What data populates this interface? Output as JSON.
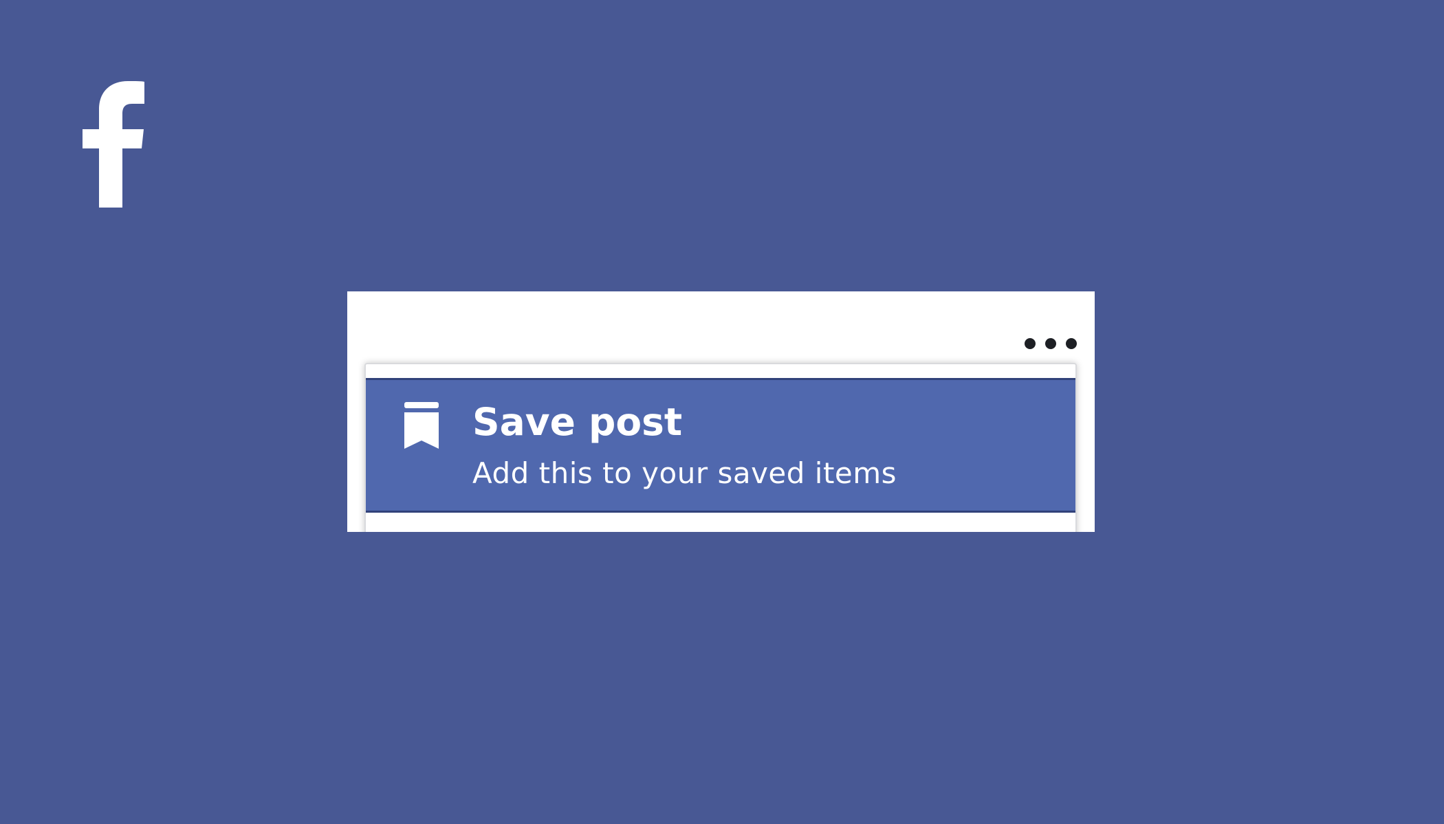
{
  "theme": {
    "background": "#485894",
    "accent": "#5068ae",
    "card_background": "#ffffff"
  },
  "brand": {
    "logo_icon": "facebook-f-icon"
  },
  "post": {
    "more_options_icon": "more-horizontal-icon"
  },
  "menu": {
    "items": [
      {
        "icon": "bookmark-icon",
        "title": "Save post",
        "subtitle": "Add this to your saved items"
      }
    ]
  }
}
